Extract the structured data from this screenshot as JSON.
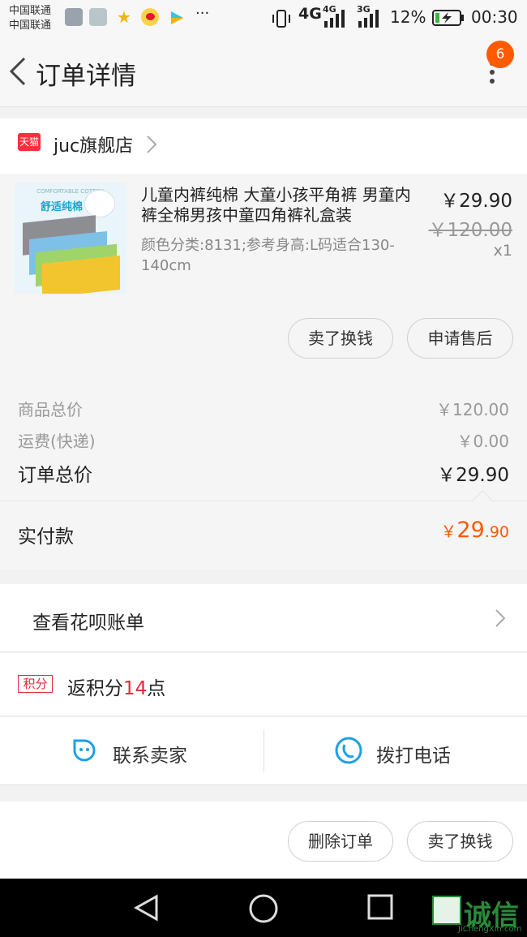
{
  "status_bar": {
    "carrier1": "中国联通",
    "carrier2": "中国联通",
    "network1": "4G",
    "network1b": "4G",
    "network2": "3G",
    "battery": "12%",
    "time": "00:30",
    "more": "···"
  },
  "header": {
    "title": "订单详情",
    "badge_count": "6"
  },
  "shop": {
    "badge": "天猫",
    "name": "juc旗舰店"
  },
  "item": {
    "thumb_label": "舒适纯棉",
    "thumb_sub": "COMFORTABLE COTTON",
    "title": "儿童内裤纯棉 大童小孩平角裤 男童内裤全棉男孩中童四角裤礼盒装",
    "spec": "颜色分类:8131;参考身高:L码适合130-140cm",
    "price_now": "￥29.90",
    "price_old": "￥120.00",
    "qty": "x1",
    "btn_sell": "卖了换钱",
    "btn_after_sale": "申请售后"
  },
  "totals": {
    "goods_label": "商品总价",
    "goods_value": "￥120.00",
    "shipping_label": "运费(快递)",
    "shipping_value": "￥0.00",
    "order_total_label": "订单总价",
    "order_total_value": "￥29.90",
    "paid_label": "实付款",
    "paid_symbol": "￥",
    "paid_int": "29",
    "paid_dec": ".90"
  },
  "huabei": {
    "label": "查看花呗账单"
  },
  "points": {
    "tag": "积分",
    "prefix": "返积分",
    "number": "14",
    "suffix": "点"
  },
  "contact": {
    "seller": "联系卖家",
    "call": "拨打电话"
  },
  "actions": {
    "delete": "删除订单",
    "sell": "卖了换钱"
  },
  "watermark": {
    "brand": "诚信",
    "site": "JiChengXin.com"
  },
  "colors": {
    "accent": "#ff5a00",
    "tmall": "#ff2e3c",
    "points": "#e6283c",
    "icon_blue": "#1ea0e6"
  }
}
